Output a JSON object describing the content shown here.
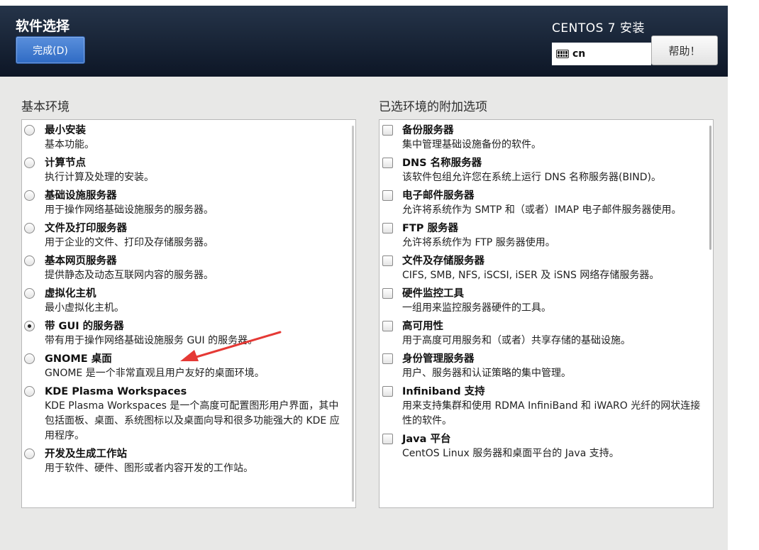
{
  "header": {
    "title": "软件选择",
    "done_label": "完成(D)",
    "product": "CENTOS 7 安装",
    "keyboard": "cn",
    "help_label": "帮助！"
  },
  "base": {
    "title": "基本环境",
    "items": [
      {
        "name": "最小安装",
        "desc": "基本功能。",
        "selected": false
      },
      {
        "name": "计算节点",
        "desc": "执行计算及处理的安装。",
        "selected": false
      },
      {
        "name": "基础设施服务器",
        "desc": "用于操作网络基础设施服务的服务器。",
        "selected": false
      },
      {
        "name": "文件及打印服务器",
        "desc": "用于企业的文件、打印及存储服务器。",
        "selected": false
      },
      {
        "name": "基本网页服务器",
        "desc": "提供静态及动态互联网内容的服务器。",
        "selected": false
      },
      {
        "name": "虚拟化主机",
        "desc": "最小虚拟化主机。",
        "selected": false
      },
      {
        "name": "带 GUI 的服务器",
        "desc": "带有用于操作网络基础设施服务 GUI 的服务器。",
        "selected": true
      },
      {
        "name": "GNOME 桌面",
        "desc": "GNOME 是一个非常直观且用户友好的桌面环境。",
        "selected": false
      },
      {
        "name": "KDE Plasma Workspaces",
        "desc": "KDE Plasma Workspaces 是一个高度可配置图形用户界面，其中包括面板、桌面、系统图标以及桌面向导和很多功能强大的 KDE 应用程序。",
        "selected": false
      },
      {
        "name": "开发及生成工作站",
        "desc": "用于软件、硬件、图形或者内容开发的工作站。",
        "selected": false
      }
    ]
  },
  "addons": {
    "title": "已选环境的附加选项",
    "items": [
      {
        "name": "备份服务器",
        "desc": "集中管理基础设施备份的软件。",
        "checked": false
      },
      {
        "name": "DNS 名称服务器",
        "desc": "该软件包组允许您在系统上运行 DNS 名称服务器(BIND)。",
        "checked": false
      },
      {
        "name": "电子邮件服务器",
        "desc": "允许将系统作为 SMTP 和（或者）IMAP 电子邮件服务器使用。",
        "checked": false
      },
      {
        "name": "FTP 服务器",
        "desc": "允许将系统作为 FTP 服务器使用。",
        "checked": false
      },
      {
        "name": "文件及存储服务器",
        "desc": "CIFS, SMB, NFS, iSCSI, iSER 及 iSNS 网络存储服务器。",
        "checked": false
      },
      {
        "name": "硬件监控工具",
        "desc": "一组用来监控服务器硬件的工具。",
        "checked": false
      },
      {
        "name": "高可用性",
        "desc": "用于高度可用服务和（或者）共享存储的基础设施。",
        "checked": false
      },
      {
        "name": "身份管理服务器",
        "desc": "用户、服务器和认证策略的集中管理。",
        "checked": false
      },
      {
        "name": "Infiniband 支持",
        "desc": "用来支持集群和使用 RDMA InfiniBand 和 iWARO 光纤的网状连接性的软件。",
        "checked": false
      },
      {
        "name": "Java 平台",
        "desc": "CentOS Linux 服务器和桌面平台的 Java 支持。",
        "checked": false
      }
    ]
  },
  "colors": {
    "header_top": "#253449",
    "header_bottom": "#0d1626",
    "done_button": "#3b78d0",
    "annotation_arrow": "#e53935"
  }
}
